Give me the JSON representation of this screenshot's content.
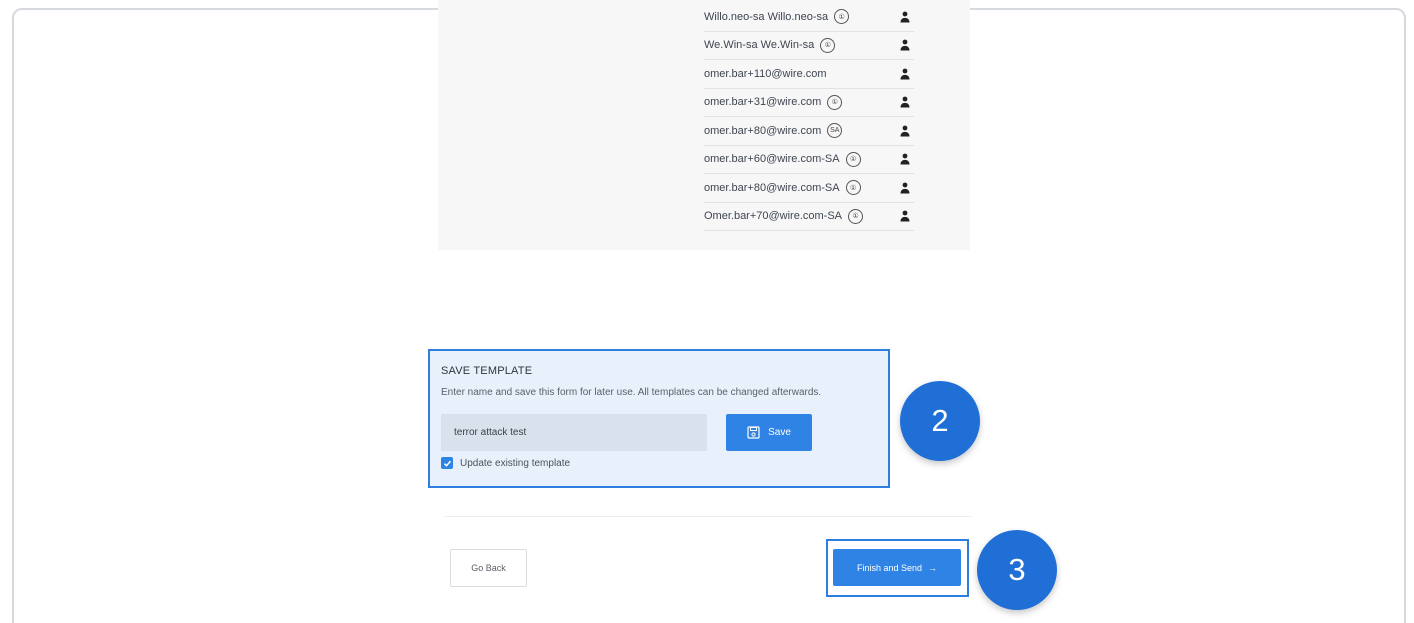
{
  "recipients": [
    {
      "text": "Willo.neo-sa Willo.neo-sa",
      "badge": "①"
    },
    {
      "text": "We.Win-sa We.Win-sa",
      "badge": "①"
    },
    {
      "text": "omer.bar+110@wire.com",
      "badge": ""
    },
    {
      "text": "omer.bar+31@wire.com",
      "badge": "①"
    },
    {
      "text": "omer.bar+80@wire.com",
      "badge": "SA"
    },
    {
      "text": "omer.bar+60@wire.com-SA",
      "badge": "①"
    },
    {
      "text": "omer.bar+80@wire.com-SA",
      "badge": "①"
    },
    {
      "text": "Omer.bar+70@wire.com-SA",
      "badge": "①"
    }
  ],
  "template": {
    "title": "SAVE TEMPLATE",
    "description": "Enter name and save this form for later use. All templates can be changed afterwards.",
    "name_value": "terror attack test",
    "save_label": "Save",
    "update_label": "Update existing template"
  },
  "steps": {
    "save_step": "2",
    "finish_step": "3"
  },
  "footer": {
    "go_back_label": "Go Back",
    "finish_label": "Finish and Send",
    "finish_arrow": "→"
  },
  "colors": {
    "accent": "#2f83e5",
    "step_badge": "#1f6fd6",
    "highlight": "#2d7ee0"
  }
}
